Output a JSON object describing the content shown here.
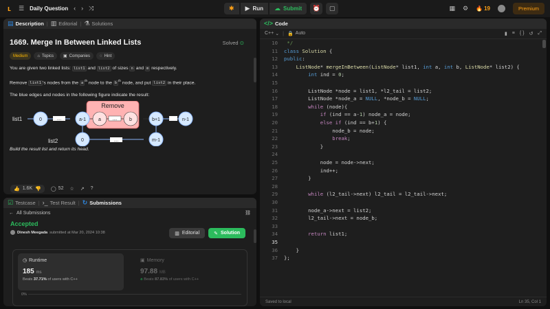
{
  "topbar": {
    "title": "Daily Question",
    "run": "Run",
    "submit": "Submit",
    "streak": "19",
    "premium": "Premium"
  },
  "description": {
    "tabs": [
      "Description",
      "Editorial",
      "Solutions"
    ],
    "title": "1669. Merge In Between Linked Lists",
    "solved": "Solved",
    "chips": [
      "Medium",
      "Topics",
      "Companies",
      "Hint"
    ],
    "p1": {
      "a": "You are given two linked lists: ",
      "c1": "list1",
      "b": " and ",
      "c2": "list2",
      "c": " of sizes ",
      "c3": "n",
      "d": " and ",
      "c4": "m",
      "e": " respectively."
    },
    "p2": {
      "a": "Remove ",
      "c1": "list1",
      "b": "'s nodes from the ",
      "c2": "a",
      "s1": "th",
      "c": " node to the ",
      "c3": "b",
      "s2": "th",
      "d": " node, and put ",
      "c4": "list2",
      "e": " in their place."
    },
    "p3": "The blue edges and nodes in the following figure indicate the result:",
    "p4": "Build the result list and return its head.",
    "diagram": {
      "remove_label": "Remove",
      "list1": "list1",
      "list2": "list2",
      "dots": "....",
      "nodes": [
        "0",
        "a-1",
        "a",
        "b",
        "b+1",
        "n-1",
        "0",
        "m-1"
      ]
    },
    "likes": "1.6K",
    "comments": "52"
  },
  "results": {
    "tabs": [
      "Testcase",
      "Test Result",
      "Submissions"
    ],
    "back": "All Submissions",
    "status": "Accepted",
    "author": "Dinesh Meegada",
    "submitted": "submitted at Mar 20, 2024 10:38",
    "editorial": "Editorial",
    "solution": "Solution",
    "runtime": {
      "label": "Runtime",
      "value": "185",
      "unit": "ms",
      "beats_prefix": "Beats ",
      "beats": "37.71%",
      "beats_suffix": " of users with C++"
    },
    "memory": {
      "label": "Memory",
      "value": "97.88",
      "unit": "MB",
      "beats_prefix": "Beats ",
      "beats": "87.83%",
      "beats_suffix": " of users with C++"
    },
    "pct": "0%"
  },
  "code": {
    "tab": "Code",
    "language": "C++",
    "mode": "Auto",
    "footer_left": "Saved to local",
    "footer_right": "Ln 35, Col 1"
  }
}
